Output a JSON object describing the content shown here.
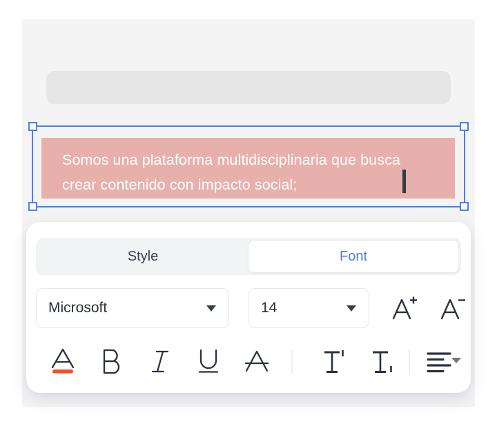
{
  "canvas": {
    "placeholder_block": {
      "name": "empty-content-block",
      "text": ""
    },
    "text_block": {
      "content": "Somos una plataforma multidisciplinaria que busca crear contenido con impacto social;",
      "background_color": "#E8B0AC",
      "text_color": "#FFFFFF",
      "caret_color": "#343B47",
      "selected": true
    },
    "selection": {
      "border_color": "#4A7CF7",
      "handle_fill": "#FFFFFF",
      "handles": [
        "top-left",
        "top-right",
        "bottom-left",
        "bottom-right"
      ]
    }
  },
  "format_panel": {
    "tabs": [
      {
        "label": "Style",
        "active": false
      },
      {
        "label": "Font",
        "active": true
      }
    ],
    "active_tab_color": "#4A7CF7",
    "font_family": {
      "label": "Microsoft",
      "placeholder": "Font family"
    },
    "font_size": {
      "label": "14",
      "placeholder": "Size"
    },
    "size_buttons": [
      {
        "name": "increase-font-size-button",
        "glyph": "A+"
      },
      {
        "name": "decrease-font-size-button",
        "glyph": "A-"
      }
    ],
    "tools": [
      {
        "name": "text-color-icon",
        "label": "A",
        "active": true,
        "accent": "#F4502B"
      },
      {
        "name": "bold-icon",
        "label": "B",
        "active": false
      },
      {
        "name": "italic-icon",
        "label": "I",
        "active": false
      },
      {
        "name": "underline-icon",
        "label": "U",
        "active": false
      },
      {
        "name": "strikethrough-icon",
        "label": "A",
        "active": false
      },
      {
        "name": "superscript-icon",
        "label": "T",
        "active": false
      },
      {
        "name": "subscript-icon",
        "label": "T",
        "active": false
      },
      {
        "name": "align-left-icon",
        "label": "align",
        "active": false
      }
    ],
    "icon_color": "#2A3040",
    "divider_color": "#ECEEF2"
  }
}
